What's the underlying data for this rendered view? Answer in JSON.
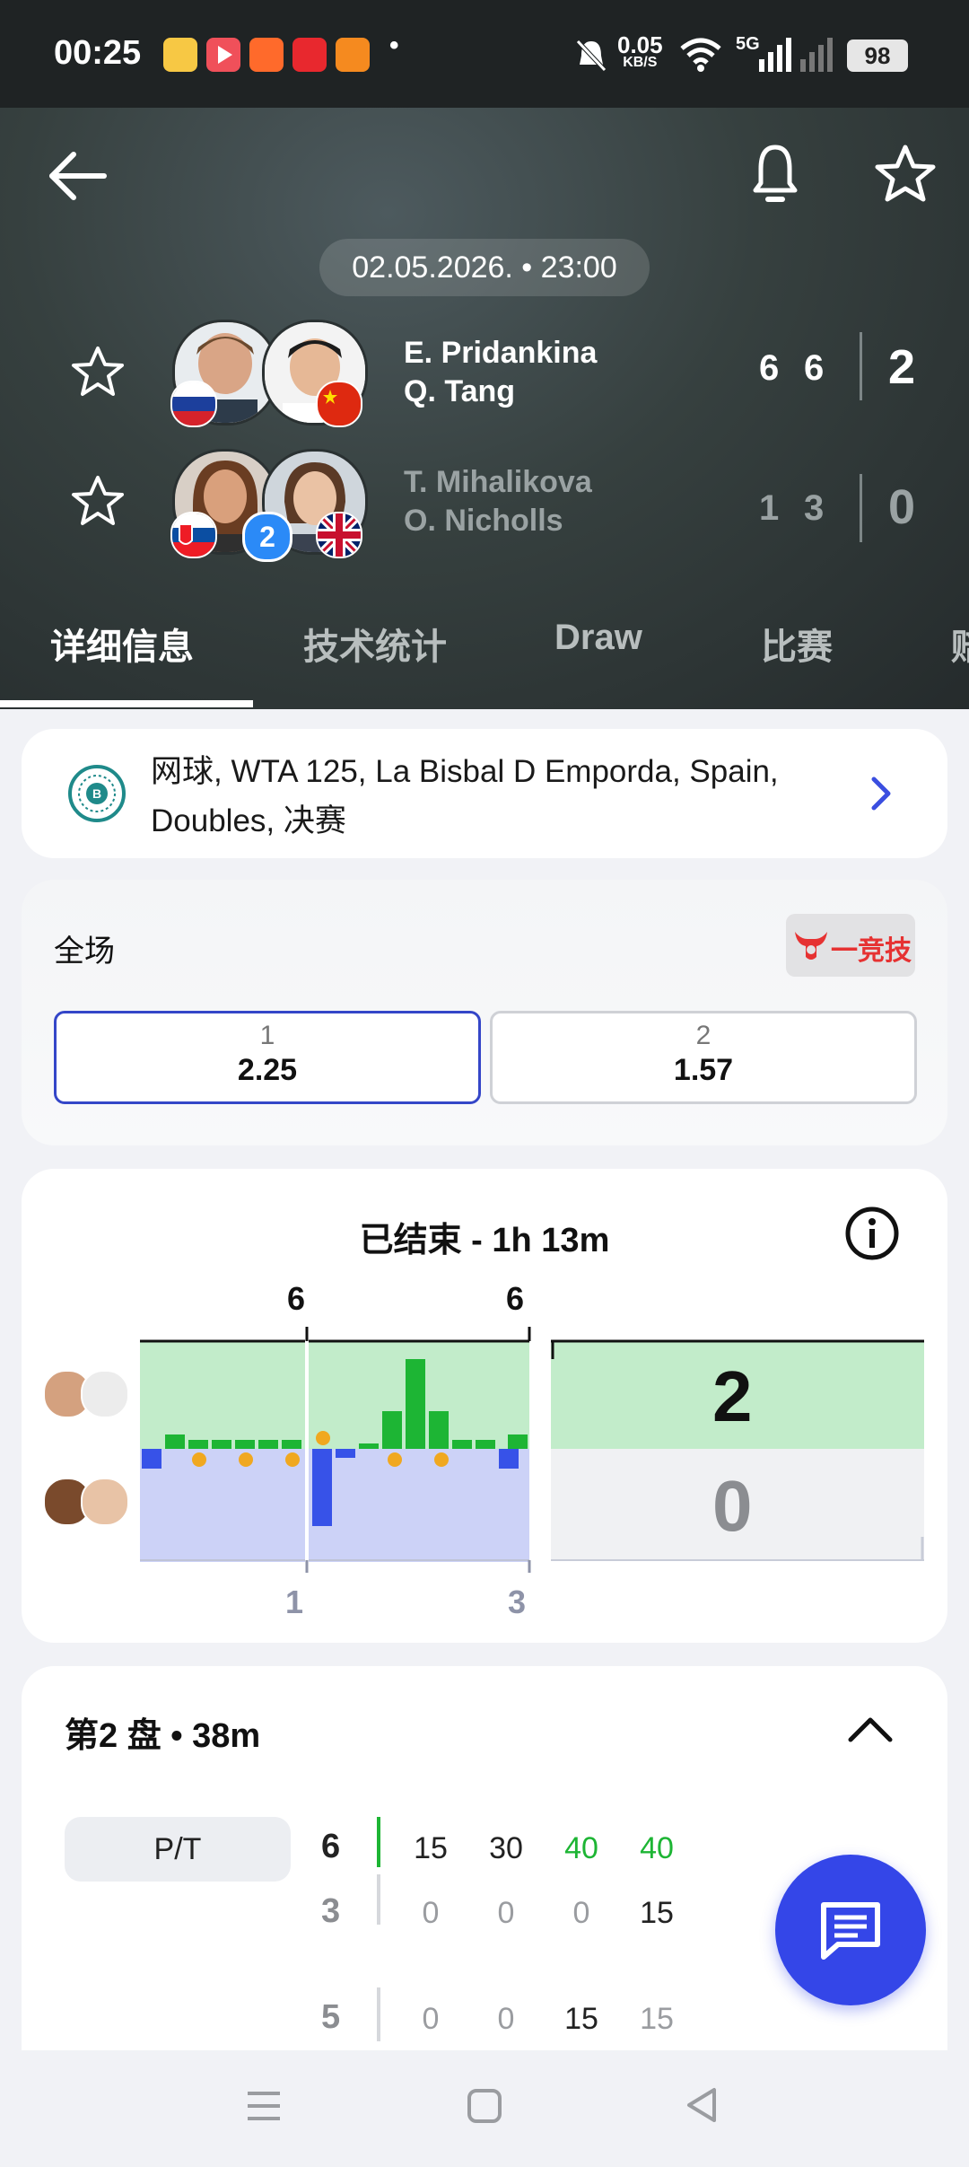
{
  "status_bar": {
    "time": "00:25",
    "app_icons": [
      "weibo-icon",
      "video-icon",
      "shop-icon",
      "store-icon",
      "game-icon"
    ],
    "dot": "•",
    "network_speed": "0.05",
    "network_unit": "KB/S",
    "signal_label": "5G",
    "battery": "98"
  },
  "header": {
    "date_time": "02.05.2026. • 23:00"
  },
  "teams": [
    {
      "player1": "E. Pridankina",
      "player2": "Q. Tang",
      "set1": "6",
      "set2": "6",
      "sets_won": "2",
      "flags": [
        "russia",
        "china"
      ],
      "winner": true
    },
    {
      "player1": "T. Mihalikova",
      "player2": "O. Nicholls",
      "set1": "1",
      "set2": "3",
      "sets_won": "0",
      "flags": [
        "slovakia",
        "uk"
      ],
      "seed": "2",
      "winner": false
    }
  ],
  "tabs": [
    {
      "label": "详细信息",
      "active": true
    },
    {
      "label": "技术统计",
      "active": false
    },
    {
      "label": "Draw",
      "active": false
    },
    {
      "label": "比赛",
      "active": false
    },
    {
      "label": "赔",
      "active": false
    }
  ],
  "tournament": {
    "line1": "网球, WTA 125, La Bisbal D Emporda, Spain,",
    "line2": "Doubles, 决赛"
  },
  "odds": {
    "title": "全场",
    "bookmaker": "一竞技",
    "options": [
      {
        "label": "1",
        "value": "2.25",
        "selected": true
      },
      {
        "label": "2",
        "value": "1.57",
        "selected": false
      }
    ]
  },
  "momentum": {
    "title": "已结束 - 1h 13m",
    "top_set_labels": [
      "6",
      "6"
    ],
    "bottom_set_labels": [
      "1",
      "3"
    ],
    "sets_score_top": "2",
    "sets_score_bottom": "0",
    "colors": {
      "team1": "#1db534",
      "team2": "#3752e8",
      "team1_bg": "#c2ecca",
      "team2_bg": "#ccd2f7",
      "ball": "#f0a820"
    }
  },
  "set_detail": {
    "title": "第2 盘 • 38m",
    "filter_label": "P/T",
    "rows": [
      {
        "game_top": "6",
        "game_bottom": "3",
        "points_top": [
          "15",
          "30",
          "40",
          "40"
        ],
        "points_bottom": [
          "0",
          "0",
          "0",
          "15"
        ]
      },
      {
        "game_top": "5",
        "points_top": [
          "0",
          "0",
          "15",
          "15"
        ]
      }
    ]
  }
}
